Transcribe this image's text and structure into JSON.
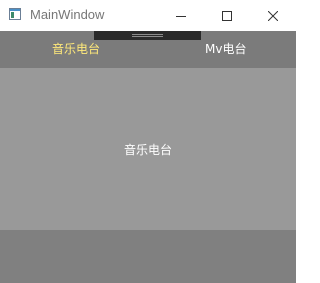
{
  "window": {
    "title": "MainWindow",
    "icon": "app-window-icon"
  },
  "title_controls": {
    "minimize": "minimize-icon",
    "maximize": "maximize-icon",
    "close": "close-icon"
  },
  "tabs": [
    {
      "label": "音乐电台",
      "selected": true
    },
    {
      "label": "Mv电台",
      "selected": false
    }
  ],
  "content": {
    "label": "音乐电台"
  },
  "colors": {
    "selected_tab_text": "#ffe97a",
    "tab_text": "#ffffff",
    "tabbar_bg": "#7b7b7b",
    "content_bg": "#999999",
    "footer_bg": "#808080"
  }
}
